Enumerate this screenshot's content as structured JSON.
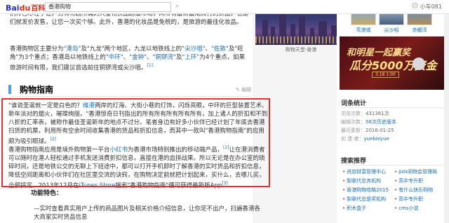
{
  "header": {
    "logo_text": "Bai",
    "logo_paw": "du",
    "logo_baike": "百科",
    "search_value": "香港购物",
    "user_name": "小车081"
  },
  "article": {
    "p1": "，壹点会通过，沙卯积，当地们的并平一个同时的局新宣传，我把一个最们设计，说的心意们传色尽在于让。另有特超所确的大型化快品超级市场，同带有最新最潮流行的货品，也是们就发价发售，让您一次买个够。此外，香港的化妆品是免税的，是旅游的最佳化妆品。",
    "p2_a": "香港购物区主要分为",
    "p2_l1": "\"港岛\"",
    "p2_b": "及\"九龙\"两个地区，九龙以地铁线上的",
    "p2_l2": "\"尖沙咀\"",
    "p2_c": "、",
    "p2_l3": "\"佐敦\"",
    "p2_d": "及\"旺角\"为3个重点；香港岛以地铁线上的",
    "p2_l4": "\"中环\"",
    "p2_e": "、",
    "p2_l5": "\"金钟\"",
    "p2_f": "、",
    "p2_l6": "\"铜锣湾\"",
    "p2_g": "及",
    "p2_l7": "\"上环\"",
    "p2_h": "为4个重点，如果旅游时间有限，我们建议首选前往铜锣湾或尖沙咀。",
    "p2_sup": "[1]",
    "section_title": "购物指南",
    "section_edit": "✎ 编辑",
    "h1_a": "\"谁说圣诞就一定是白色的？",
    "h1_l1": "维港",
    "h1_b": "两岸的灯海、大街小巷的灯饰，闪烁亮眼，中环的巨型装置艺术、新年派对的烟火，璀璨绚丽。\"香港惊奇日刊指出的所有所有所有所有所有，加上诸人的折扣和不到八折的汇率表，被称作最佳圣诞新年的地点不过分。笔者身边有好多小伙伴已经计划了年底去香港扫货的机票，利用所有空余时间收集香港的货品和折扣信息，而其中一款叫\"香港购物指南\"的应用颇为吸引眼球。",
    "h1_sup": "[2]",
    "h2_a": "香港购物指南应用是境外购物第一平台",
    "h2_l1": "小红书",
    "h2_b": "为香港市场特别推出的移动端产品，",
    "h2_sup1": "[2]",
    "h2_c": "让在港消费者可以随时在港人轻松通过手机发送消费折扣信息，直接在港的血拼战果。所以无论是在办公室的琐碎时间，还是地铁公交的无聊上下班途中，都可以打开手机即时了解香港的实时货品和折扣信息，降低空间距离和小伙伴们在社区里交流的诀窍，在购物决定前就把计划起来，买什么，去哪儿买，全部搞定。2013年12月在",
    "h2_l2": "iTunes Store",
    "h2_d": "搜索\"香港购物指南\"便可获得最新版App",
    "h2_sup2": "[3]",
    "subhead": "功能特色：",
    "p3": "—实时查看真实用户上传的商品图片及相关价格介绍信息，让你足不出户，扫遍香港各大商家实时货品信息"
  },
  "photo": {
    "caption": "购物天堂-香港"
  },
  "sidebar": {
    "thumb_labels": [
      "弯港城",
      "尖沙咀",
      "赤鱲湾"
    ],
    "ad": {
      "t1": "和明星一起赢奖",
      "t2": "瓜分5000万资金",
      "t3": "3.18 1:00"
    },
    "stats_title": "词条统计",
    "stats": [
      {
        "label": "浏览次数：",
        "value": "431361次"
      },
      {
        "label": "编辑次数：",
        "value": "56次历史版本"
      },
      {
        "label": "最近更新：",
        "value": "2016-01-25"
      },
      {
        "label": "创 建 者：",
        "value": "yuebieyue"
      }
    ],
    "related_title": "搜索推荐",
    "related": [
      [
        "进店财富管理中心",
        "pdx同物会管理局"
      ],
      [
        "梨渠代总务机构",
        "高中专升职"
      ],
      [
        "香港购物攻略2015",
        "有什么快乐购物"
      ],
      [
        "梨渠代总是奖机构",
        "高中专升职"
      ],
      [
        "积木盒子",
        "cms小说"
      ]
    ]
  }
}
